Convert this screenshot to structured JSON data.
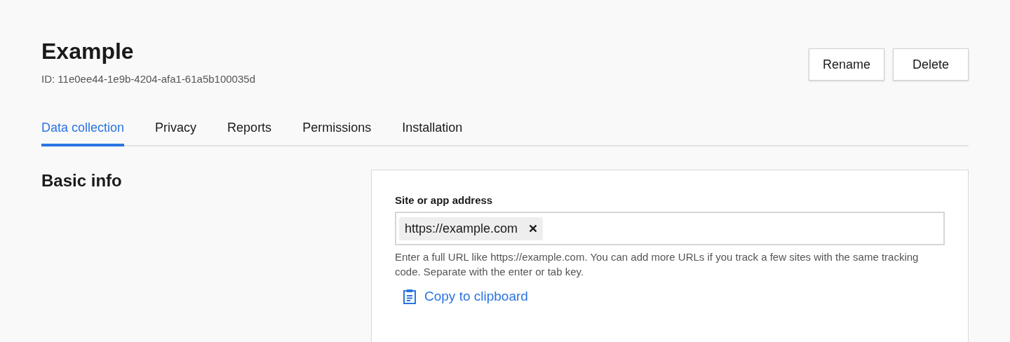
{
  "header": {
    "title": "Example",
    "id_text": "ID: 11e0ee44-1e9b-4204-afa1-61a5b100035d",
    "buttons": [
      "Rename",
      "Delete"
    ]
  },
  "tabs": [
    {
      "label": "Data collection",
      "selected": true
    },
    {
      "label": "Privacy",
      "selected": false
    },
    {
      "label": "Reports",
      "selected": false
    },
    {
      "label": "Permissions",
      "selected": false
    },
    {
      "label": "Installation",
      "selected": false
    }
  ],
  "section": {
    "title": "Basic info",
    "field": {
      "label": "Site or app address",
      "tags": [
        "https://example.com"
      ],
      "help": "Enter a full URL like https://example.com. You can add more URLs if you track a few sites with the same tracking code. Separate with the enter or tab key."
    },
    "link": "Copy to clipboard"
  }
}
